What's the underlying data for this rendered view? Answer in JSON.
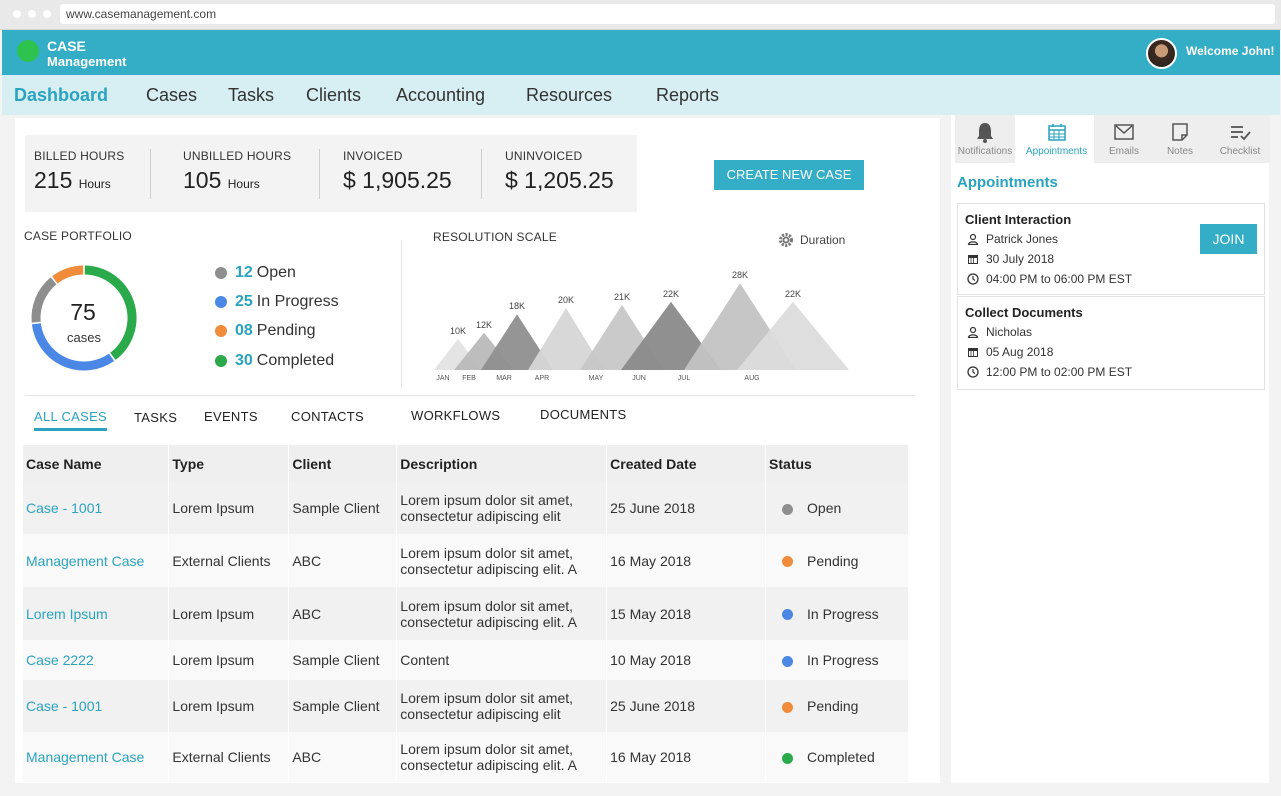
{
  "browser": {
    "url": "www.casemanagement.com"
  },
  "header": {
    "logo_line1": "CASE",
    "logo_line2": "Management",
    "welcome": "Welcome John!",
    "avatar_icon": "user-avatar"
  },
  "nav": {
    "items": [
      "Dashboard",
      "Cases",
      "Tasks",
      "Clients",
      "Accounting",
      "Resources",
      "Reports"
    ],
    "active": "Dashboard"
  },
  "stats": [
    {
      "label": "BILLED HOURS",
      "value": "215",
      "unit": "Hours"
    },
    {
      "label": "UNBILLED HOURS",
      "value": "105",
      "unit": "Hours"
    },
    {
      "label": "INVOICED",
      "value": "$ 1,905.25",
      "unit": ""
    },
    {
      "label": "UNINVOICED",
      "value": "$ 1,205.25",
      "unit": ""
    }
  ],
  "create_button": "CREATE NEW CASE",
  "portfolio": {
    "title": "CASE PORTFOLIO",
    "total": "75",
    "total_label": "cases",
    "items": [
      {
        "count": "12",
        "label": "Open",
        "color": "#8e8e8e"
      },
      {
        "count": "25",
        "label": "In Progress",
        "color": "#4b88e6"
      },
      {
        "count": "08",
        "label": "Pending",
        "color": "#f08c3a"
      },
      {
        "count": "30",
        "label": "Completed",
        "color": "#2aaa4a"
      }
    ]
  },
  "resolution": {
    "title": "RESOLUTION SCALE",
    "duration_label": "Duration",
    "peaks": [
      {
        "month": "JAN",
        "value": "10K"
      },
      {
        "month": "FEB",
        "value": "12K"
      },
      {
        "month": "MAR",
        "value": "18K"
      },
      {
        "month": "APR",
        "value": "20K"
      },
      {
        "month": "MAY",
        "value": "21K"
      },
      {
        "month": "JUN",
        "value": "22K"
      },
      {
        "month": "JUL",
        "value": "28K"
      },
      {
        "month": "AUG",
        "value": "22K"
      }
    ]
  },
  "tabs": [
    "ALL CASES",
    "TASKS",
    "EVENTS",
    "CONTACTS",
    "WORKFLOWS",
    "DOCUMENTS"
  ],
  "table": {
    "headers": [
      "Case Name",
      "Type",
      "Client",
      "Description",
      "Created Date",
      "Status"
    ],
    "rows": [
      {
        "name": "Case - 1001",
        "type": "Lorem Ipsum",
        "client": "Sample Client",
        "desc1": "Lorem ipsum dolor sit amet,",
        "desc2": "consectetur adipiscing elit",
        "date": "25 June 2018",
        "status": "Open",
        "color": "#8e8e8e"
      },
      {
        "name": "Management Case",
        "type": "External Clients",
        "client": "ABC",
        "desc1": "Lorem ipsum dolor sit amet,",
        "desc2": "consectetur adipiscing elit. A",
        "date": "16 May 2018",
        "status": "Pending",
        "color": "#f08c3a"
      },
      {
        "name": "Lorem Ipsum",
        "type": "Lorem Ipsum",
        "client": "ABC",
        "desc1": "Lorem ipsum dolor sit amet,",
        "desc2": "consectetur adipiscing elit. A",
        "date": "15 May 2018",
        "status": "In Progress",
        "color": "#4b88e6"
      },
      {
        "name": "Case 2222",
        "type": "Lorem Ipsum",
        "client": "Sample Client",
        "desc1": "Content",
        "desc2": "",
        "date": "10 May 2018",
        "status": "In Progress",
        "color": "#4b88e6"
      },
      {
        "name": "Case - 1001",
        "type": "Lorem Ipsum",
        "client": "Sample Client",
        "desc1": "Lorem ipsum dolor sit amet,",
        "desc2": "consectetur adipiscing elit",
        "date": "25 June 2018",
        "status": "Pending",
        "color": "#f08c3a"
      },
      {
        "name": "Management Case",
        "type": "External Clients",
        "client": "ABC",
        "desc1": "Lorem ipsum dolor sit amet,",
        "desc2": "consectetur adipiscing elit. A",
        "date": "16 May 2018",
        "status": "Completed",
        "color": "#2aaa4a"
      }
    ]
  },
  "right_tabs": [
    {
      "label": "Notifications",
      "icon": "bell-icon"
    },
    {
      "label": "Appointments",
      "icon": "calendar-icon"
    },
    {
      "label": "Emails",
      "icon": "envelope-icon"
    },
    {
      "label": "Notes",
      "icon": "note-icon"
    },
    {
      "label": "Checklist",
      "icon": "checklist-icon"
    }
  ],
  "appointments": {
    "title": "Appointments",
    "join_label": "JOIN",
    "items": [
      {
        "title": "Client Interaction",
        "person": "Patrick Jones",
        "date": "30 July 2018",
        "time": "04:00 PM to 06:00 PM EST"
      },
      {
        "title": "Collect Documents",
        "person": "Nicholas",
        "date": "05 Aug 2018",
        "time": "12:00 PM to 02:00 PM EST"
      }
    ]
  }
}
